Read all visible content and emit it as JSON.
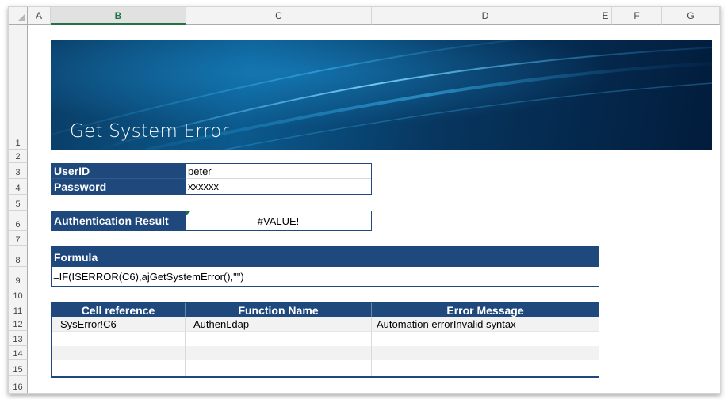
{
  "columns": [
    "A",
    "B",
    "C",
    "D",
    "E",
    "F",
    "G"
  ],
  "selected_column": "B",
  "rows": [
    "1",
    "2",
    "3",
    "4",
    "5",
    "6",
    "7",
    "8",
    "9",
    "10",
    "11",
    "12",
    "13",
    "14",
    "15",
    "16"
  ],
  "banner": {
    "title": "Get System Error"
  },
  "credentials": {
    "userid_label": "UserID",
    "userid_value": "peter",
    "password_label": "Password",
    "password_value": "xxxxxx"
  },
  "auth": {
    "label": "Authentication Result",
    "value": "#VALUE!"
  },
  "formula": {
    "label": "Formula",
    "value": "=IF(ISERROR(C6),ajGetSystemError(),\"\")"
  },
  "error_table": {
    "headers": [
      "Cell reference",
      "Function Name",
      "Error Message"
    ],
    "rows": [
      [
        "SysError!C6",
        "AuthenLdap",
        "Automation errorInvalid syntax"
      ],
      [
        "",
        "",
        ""
      ],
      [
        "",
        "",
        ""
      ],
      [
        "",
        "",
        ""
      ]
    ]
  },
  "colors": {
    "header_blue": "#1f497d",
    "excel_green": "#217346",
    "alt_row": "#f2f2f2"
  }
}
